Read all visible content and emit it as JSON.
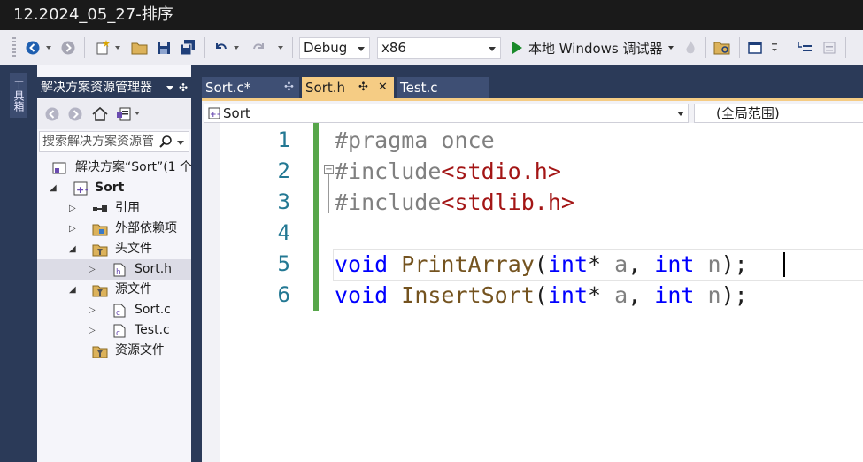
{
  "window": {
    "title": "12.2024_05_27-排序"
  },
  "toolbar": {
    "config": "Debug",
    "platform": "x86",
    "run_label": "本地 Windows 调试器",
    "icons": [
      "back-icon",
      "forward-icon",
      "new-item-icon",
      "open-file-icon",
      "save-icon",
      "save-all-icon",
      "undo-icon",
      "redo-icon",
      "start-debug-icon",
      "fire-icon",
      "folder-icon",
      "window-icon",
      "comment-icon",
      "uncomment-icon"
    ]
  },
  "tool_strip": {
    "label": "工具箱"
  },
  "solution_explorer": {
    "title": "解决方案资源管理器",
    "search_placeholder": "搜索解决方案资源管",
    "tree": [
      {
        "label": "解决方案“Sort”(1 个",
        "icon": "solution-icon"
      },
      {
        "label": "Sort",
        "icon": "project-icon",
        "expanded": true
      },
      {
        "label": "引用",
        "icon": "references-icon"
      },
      {
        "label": "外部依赖项",
        "icon": "external-deps-icon"
      },
      {
        "label": "头文件",
        "icon": "filter-folder-icon",
        "expanded": true
      },
      {
        "label": "Sort.h",
        "icon": "header-file-icon",
        "selected": true
      },
      {
        "label": "源文件",
        "icon": "filter-folder-icon",
        "expanded": true
      },
      {
        "label": "Sort.c",
        "icon": "c-file-icon"
      },
      {
        "label": "Test.c",
        "icon": "c-file-icon"
      },
      {
        "label": "资源文件",
        "icon": "filter-folder-icon"
      }
    ]
  },
  "tabs": [
    {
      "label": "Sort.c*",
      "pin": "✣"
    },
    {
      "label": "Sort.h",
      "pin": "✣",
      "close": "✕",
      "active": true
    },
    {
      "label": "Test.c"
    }
  ],
  "navbar": {
    "scope": "Sort",
    "global_scope": "(全局范围)"
  },
  "editor": {
    "line_numbers": [
      "1",
      "2",
      "3",
      "4",
      "5",
      "6"
    ],
    "lines": [
      [
        {
          "t": "#pragma once",
          "c": "k-pre"
        }
      ],
      [
        {
          "t": "#include",
          "c": "k-pre"
        },
        {
          "t": "<stdio.h>",
          "c": "k-inc"
        }
      ],
      [
        {
          "t": "#include",
          "c": "k-pre"
        },
        {
          "t": "<stdlib.h>",
          "c": "k-inc"
        }
      ],
      [],
      [
        {
          "t": "void",
          "c": "k-kw"
        },
        {
          "t": " "
        },
        {
          "t": "PrintArray",
          "c": "k-fn"
        },
        {
          "t": "("
        },
        {
          "t": "int",
          "c": "k-kw"
        },
        {
          "t": "* "
        },
        {
          "t": "a",
          "c": "k-par"
        },
        {
          "t": ", "
        },
        {
          "t": "int",
          "c": "k-kw"
        },
        {
          "t": " "
        },
        {
          "t": "n",
          "c": "k-par"
        },
        {
          "t": ");"
        }
      ],
      [
        {
          "t": "void",
          "c": "k-kw"
        },
        {
          "t": " "
        },
        {
          "t": "InsertSort",
          "c": "k-fn"
        },
        {
          "t": "("
        },
        {
          "t": "int",
          "c": "k-kw"
        },
        {
          "t": "* "
        },
        {
          "t": "a",
          "c": "k-par"
        },
        {
          "t": ", "
        },
        {
          "t": "int",
          "c": "k-kw"
        },
        {
          "t": " "
        },
        {
          "t": "n",
          "c": "k-par"
        },
        {
          "t": ");"
        }
      ]
    ]
  }
}
